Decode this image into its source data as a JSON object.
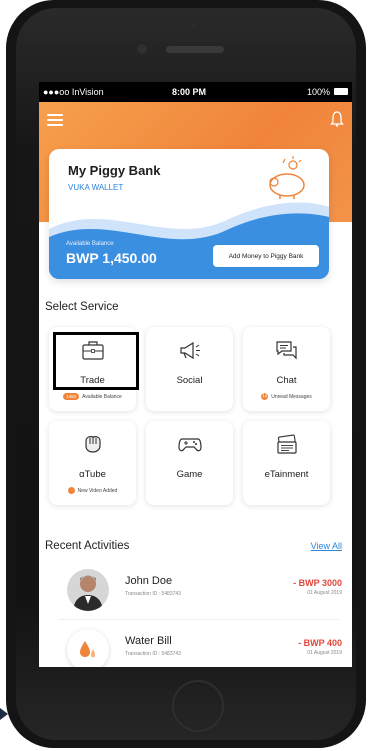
{
  "status_bar": {
    "carrier": "●●●oo InVision",
    "time": "8:00 PM",
    "battery": "100%"
  },
  "card": {
    "title": "My Piggy Bank",
    "subtitle": "VUKA WALLET",
    "balance_label": "Available Balance",
    "balance": "BWP 1,450.00",
    "add_money_label": "Add Money to Piggy Bank"
  },
  "services_title": "Select Service",
  "services": [
    {
      "label": "Trade",
      "sub": "Available Balance",
      "badge": "1450",
      "icon": "briefcase-icon"
    },
    {
      "label": "Social",
      "sub": "",
      "badge": "",
      "icon": "megaphone-icon"
    },
    {
      "label": "Chat",
      "sub": "Unread Messages",
      "badge": "12",
      "icon": "chat-icon"
    },
    {
      "label": "αTube",
      "sub": "New Video Added",
      "badge": "",
      "icon": "fist-icon"
    },
    {
      "label": "Game",
      "sub": "",
      "badge": "",
      "icon": "gamepad-icon"
    },
    {
      "label": "eTainment",
      "sub": "",
      "badge": "",
      "icon": "tickets-icon"
    }
  ],
  "recent_title": "Recent Activities",
  "view_all": "View All",
  "activities": [
    {
      "name": "John Doe",
      "transaction": "Transaction ID : 5483743",
      "amount": "- BWP 3000",
      "date": "01 August 2019"
    },
    {
      "name": "Water Bill",
      "transaction": "Transaction ID : 5483743",
      "amount": "- BWP 400",
      "date": "01 August 2019"
    }
  ],
  "colors": {
    "orange": "#f0843a",
    "blue": "#2e86d8",
    "red": "#e0463c"
  }
}
